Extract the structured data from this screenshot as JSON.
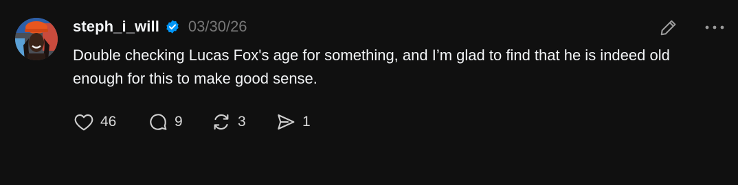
{
  "post": {
    "username": "steph_i_will",
    "timestamp": "03/30/26",
    "text": "Double checking Lucas Fox's age for something, and I’m glad to find that he is indeed old enough for this to make good sense.",
    "verified": true
  },
  "actions": {
    "like_count": "46",
    "reply_count": "9",
    "repost_count": "3",
    "share_count": "1"
  },
  "icons": {
    "verified": "verified-badge-icon",
    "edit": "pencil-icon",
    "more": "more-dots-icon",
    "like": "heart-icon",
    "reply": "comment-bubble-icon",
    "repost": "repost-arrows-icon",
    "share": "send-arrow-icon"
  },
  "colors": {
    "background": "#101010",
    "text": "#f3f5f7",
    "muted": "#777777",
    "verified": "#0095f6"
  }
}
